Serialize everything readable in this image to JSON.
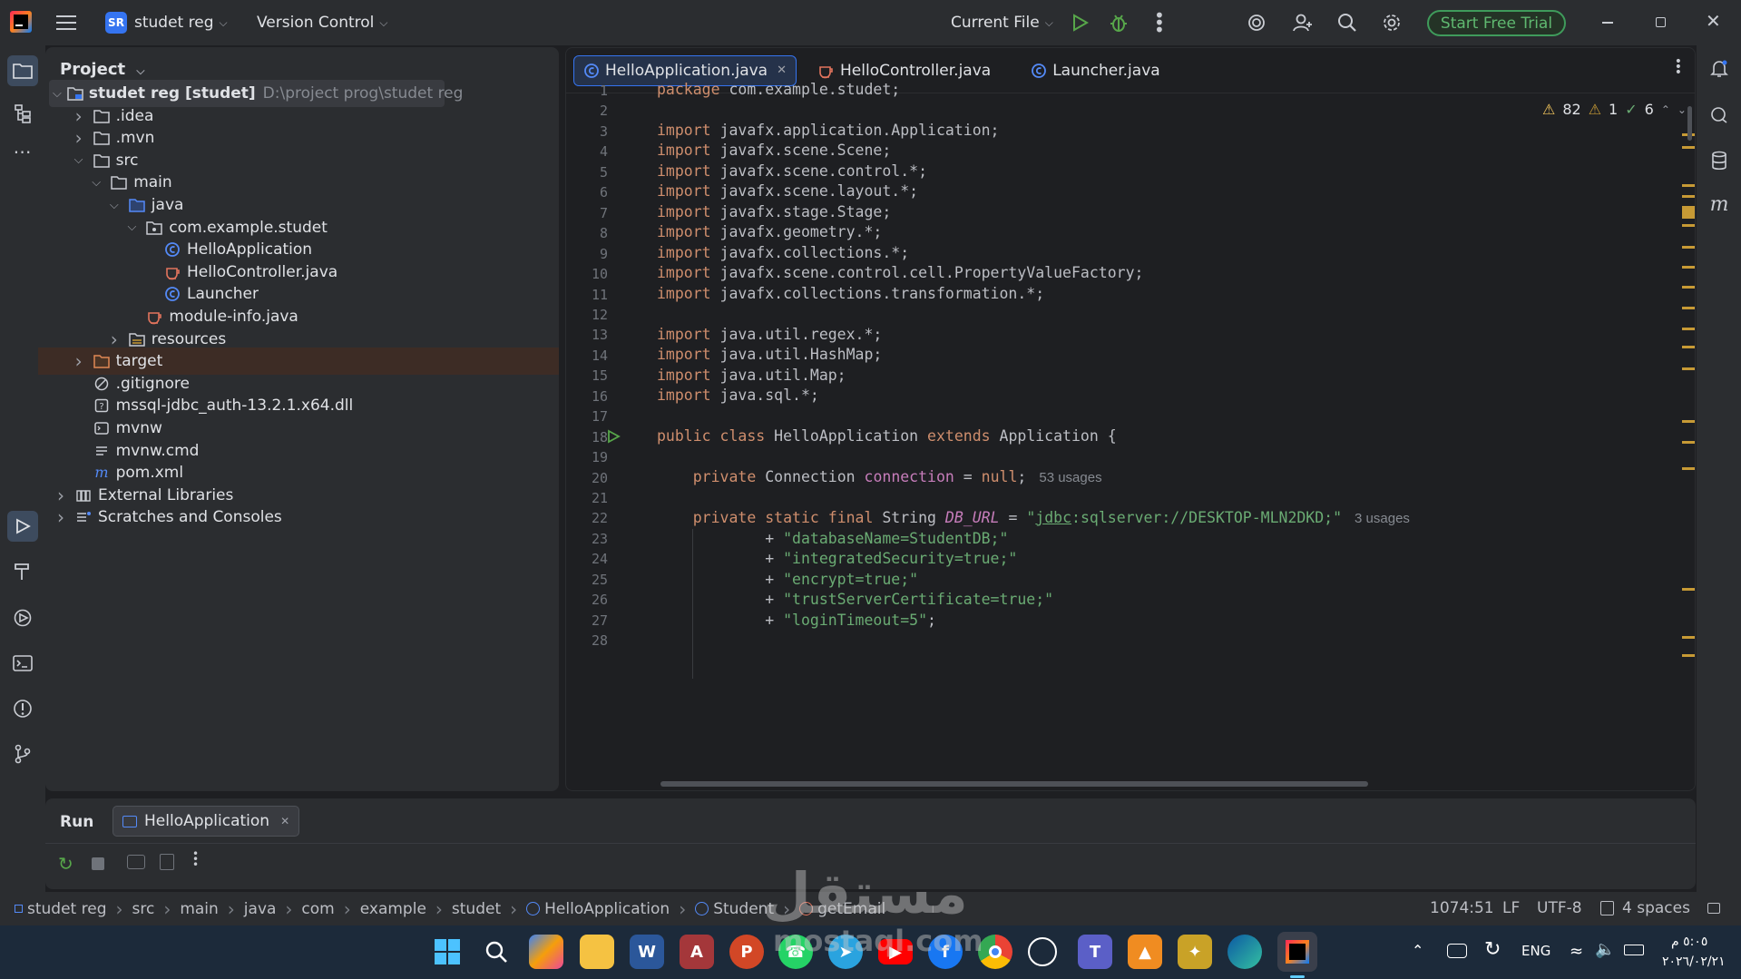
{
  "titlebar": {
    "project_badge": "SR",
    "project_name": "studet reg",
    "version_control": "Version Control",
    "run_config": "Current File",
    "trial_button": "Start Free Trial"
  },
  "project_panel": {
    "title": "Project",
    "tree": [
      {
        "label": "studet reg [studet]",
        "path": "D:\\project prog\\studet reg",
        "depth": 0,
        "icon": "module-folder-icon",
        "open": true
      },
      {
        "label": ".idea",
        "depth": 1,
        "icon": "folder-icon",
        "open": false
      },
      {
        "label": ".mvn",
        "depth": 1,
        "icon": "folder-icon",
        "open": false
      },
      {
        "label": "src",
        "depth": 1,
        "icon": "folder-icon",
        "open": true
      },
      {
        "label": "main",
        "depth": 2,
        "icon": "folder-icon",
        "open": true
      },
      {
        "label": "java",
        "depth": 3,
        "icon": "source-folder-icon",
        "open": true
      },
      {
        "label": "com.example.studet",
        "depth": 4,
        "icon": "package-icon",
        "open": true
      },
      {
        "label": "HelloApplication",
        "depth": 5,
        "icon": "java-class-icon"
      },
      {
        "label": "HelloController.java",
        "depth": 5,
        "icon": "java-file-icon"
      },
      {
        "label": "Launcher",
        "depth": 5,
        "icon": "java-class-icon"
      },
      {
        "label": "module-info.java",
        "depth": 4,
        "icon": "java-file-icon"
      },
      {
        "label": "resources",
        "depth": 3,
        "icon": "resources-folder-icon",
        "open": false
      },
      {
        "label": "target",
        "depth": 1,
        "icon": "excluded-folder-icon",
        "open": false
      },
      {
        "label": ".gitignore",
        "depth": 1,
        "icon": "ignore-file-icon"
      },
      {
        "label": "mssql-jdbc_auth-13.2.1.x64.dll",
        "depth": 1,
        "icon": "unknown-file-icon"
      },
      {
        "label": "mvnw",
        "depth": 1,
        "icon": "script-file-icon"
      },
      {
        "label": "mvnw.cmd",
        "depth": 1,
        "icon": "text-file-icon"
      },
      {
        "label": "pom.xml",
        "depth": 1,
        "icon": "maven-icon"
      },
      {
        "label": "External Libraries",
        "depth": 0,
        "icon": "library-icon",
        "open": false
      },
      {
        "label": "Scratches and Consoles",
        "depth": 0,
        "icon": "scratches-icon",
        "open": false
      }
    ]
  },
  "editor": {
    "tabs": [
      {
        "label": "HelloApplication.java",
        "active": true
      },
      {
        "label": "HelloController.java",
        "active": false
      },
      {
        "label": "Launcher.java",
        "active": false
      }
    ],
    "inspections": {
      "warnings": "82",
      "weak_warnings": "1",
      "ok": "6"
    },
    "line_numbers": [
      "1",
      "2",
      "3",
      "4",
      "5",
      "6",
      "7",
      "8",
      "9",
      "10",
      "11",
      "12",
      "13",
      "14",
      "15",
      "16",
      "17",
      "18",
      "19",
      "20",
      "21",
      "22",
      "23",
      "24",
      "25",
      "26",
      "27",
      "28"
    ],
    "usages_connection": "53 usages",
    "usages_db_url": "3 usages"
  },
  "run_panel": {
    "title": "Run",
    "tab_label": "HelloApplication"
  },
  "statusbar": {
    "breadcrumbs": [
      "studet reg",
      "src",
      "main",
      "java",
      "com",
      "example",
      "studet",
      "HelloApplication",
      "Student",
      "getEmail"
    ],
    "position": "1074:51",
    "line_sep": "LF",
    "encoding": "UTF-8",
    "indent": "4 spaces"
  },
  "taskbar": {
    "lang": "ENG",
    "time": "٥:٠٥ م",
    "date": "٢٠٢٦/٠٢/٢١"
  },
  "watermark": {
    "arabic": "مستقل",
    "latin": "mostaql.com"
  },
  "colors": {
    "accent": "#3574f0",
    "trial_green": "#5fb870",
    "keyword": "#cf8e6d",
    "string": "#6aab73",
    "field": "#c77dbb",
    "warning": "#c79a35"
  }
}
